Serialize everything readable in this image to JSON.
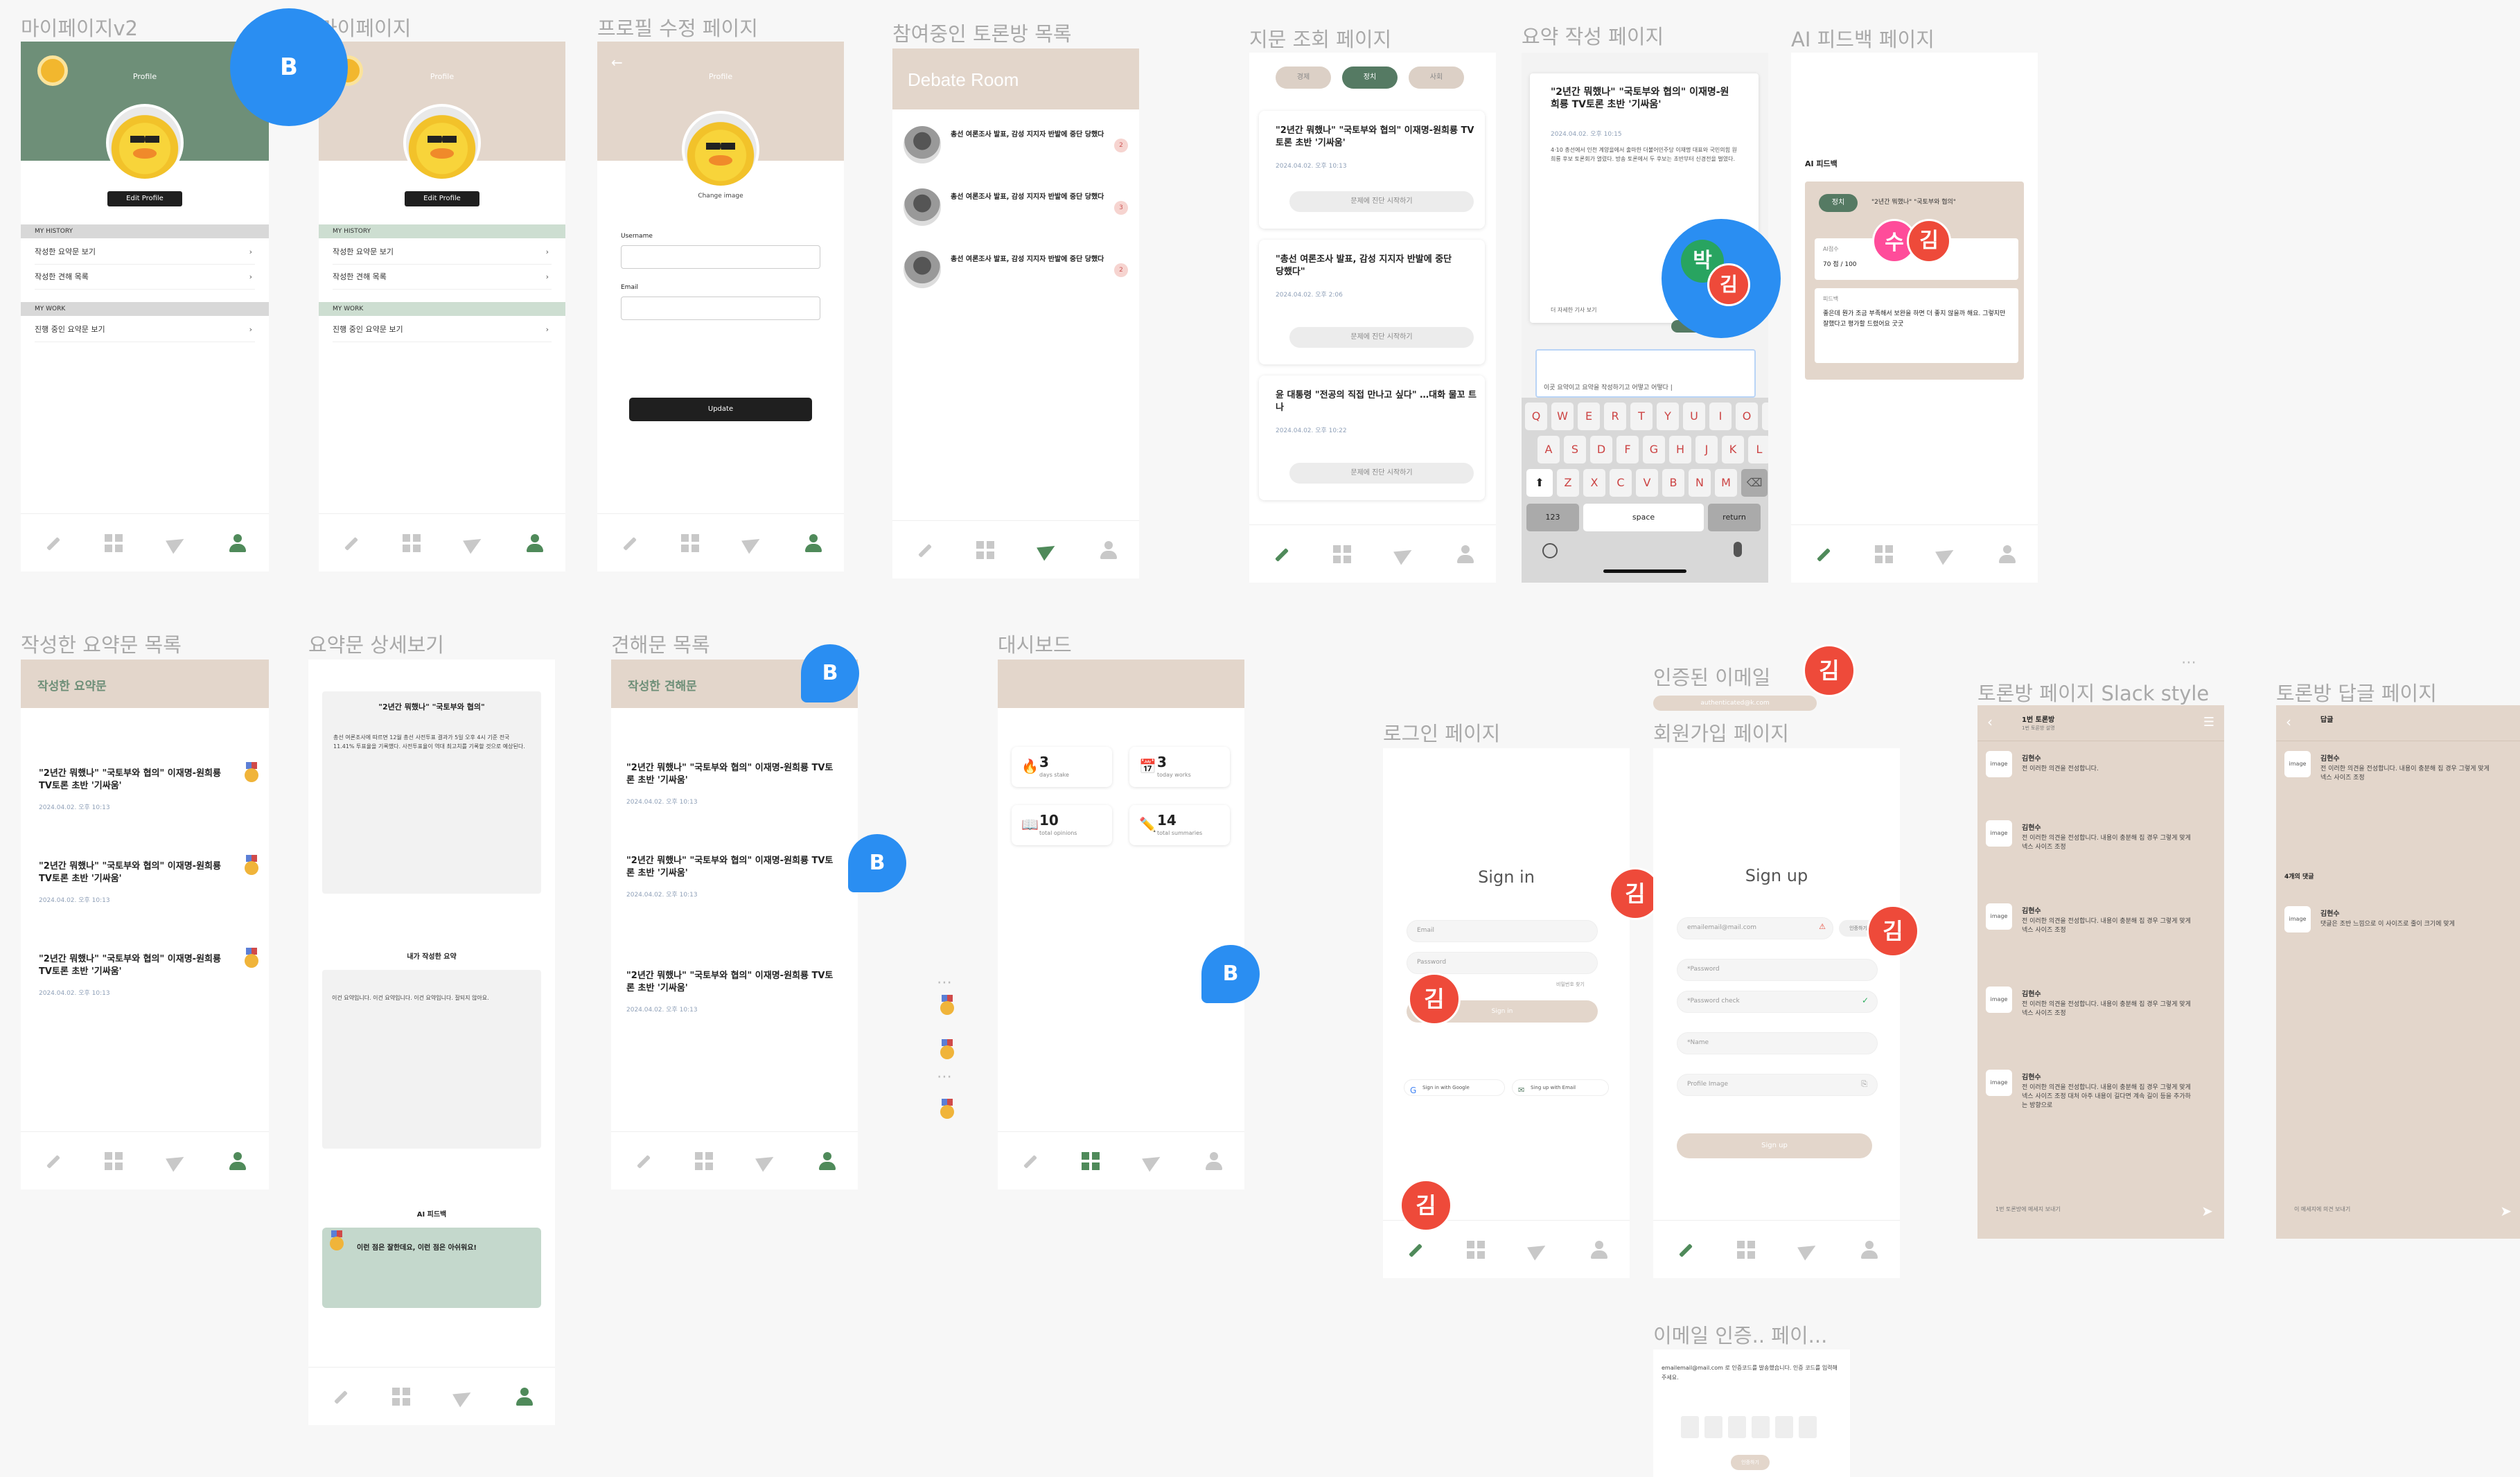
{
  "labels": {
    "mypage_v2": "마이페이지v2",
    "mypage": "마이페이지",
    "profile_edit": "프로필 수정 페이지",
    "debate_list": "참여중인 토론방 목록",
    "question_view": "지문 조회 페이지",
    "summary_write": "요약 작성 페이지",
    "ai_feedback": "AI 피드백 페이지",
    "my_summaries": "작성한 요약문 목록",
    "summary_detail": "요약문 상세보기",
    "opinion_list": "견해문 목록",
    "dashboard": "대시보드",
    "login": "로그인 페이지",
    "verified_email": "인증된 이메일",
    "signup": "회원가입 페이지",
    "room_slack": "토론방 페이지 Slack style",
    "room_reply": "토론방 답글 페이지",
    "email_verify": "이메일 인증.. 페이..."
  },
  "profile": {
    "header": "Profile",
    "edit_button": "Edit Profile",
    "my_history": "MY HISTORY",
    "history_items": [
      "작성한 요약문 보기",
      "작성한 견해 목록"
    ],
    "my_work": "MY WORK",
    "work_items": [
      "진행 중인 요약문 보기"
    ]
  },
  "profile_edit": {
    "header": "Profile",
    "change_image": "Change image",
    "username_label": "Username",
    "email_label": "Email",
    "update_button": "Update"
  },
  "debate": {
    "header": "Debate Room",
    "items": [
      {
        "title": "총선 여론조사 발표, 감성 지지자 반발에 중단 당했다",
        "badge": "2"
      },
      {
        "title": "총선 여론조사 발표, 감성 지지자 반발에 중단 당했다",
        "badge": "3"
      },
      {
        "title": "총선 여론조사 발표, 감성 지지자 반발에 중단 당했다",
        "badge": "2"
      }
    ]
  },
  "question": {
    "tabs": [
      "경제",
      "정치",
      "사회"
    ],
    "articles": [
      {
        "title": "\"2년간 뭐했나\" \"국토부와 협의\" 이재명-원희룡 TV토론 초반 '기싸움'",
        "meta": "2024.04.02. 오후 10:13",
        "button": "문제에 진단 시작하기"
      },
      {
        "title": "\"총선 여론조사 발표, 감성 지지자 반발에 중단 당했다\"",
        "meta": "2024.04.02. 오후 2:06",
        "button": "문제에 진단 시작하기"
      },
      {
        "title": "윤 대통령 \"전공의 직접 만나고 싶다\" …대화 물꼬 트나",
        "meta": "2024.04.02. 오후 10:22",
        "button": "문제에 진단 시작하기"
      }
    ]
  },
  "summary_write": {
    "title": "\"2년간 뭐했나\" \"국토부와 협의\" 이재명-원희룡 TV토론 초반 '기싸움'",
    "meta": "2024.04.02. 오후 10:15",
    "body": "4·10 총선에서 인천 계양을에서 출마한 더불어민주당 이재명 대표와 국민의힘 원희룡 후보 토론회가 열렸다. 방송 토론에서 두 후보는 초반부터 신경전을 벌였다.",
    "footer": "더 자세한 기사 보기",
    "input_placeholder": "이곳 요약이고 요약을 작성하기고 어떻고 어떻다 |",
    "keys_row1": [
      "Q",
      "W",
      "E",
      "R",
      "T",
      "Y",
      "U",
      "I",
      "O",
      "P"
    ],
    "keys_row2": [
      "A",
      "S",
      "D",
      "F",
      "G",
      "H",
      "J",
      "K",
      "L"
    ],
    "keys_row3": [
      "Z",
      "X",
      "C",
      "V",
      "B",
      "N",
      "M"
    ],
    "key_123": "123",
    "key_space": "space",
    "key_return": "return"
  },
  "ai_feedback": {
    "section": "AI 피드백",
    "tag": "정치",
    "title": "\"2년간 뭐했나\" \"국토부와 협의\"",
    "score_label": "AI점수",
    "score": "70 점 / 100",
    "feedback_label": "피드백",
    "feedback": "좋은데 뭔가 조금 부족해서 보완을 하면 더 좋지 않을까 해요. 그렇지만 잘했다고 평가할 드렸어요 굿굿"
  },
  "my_summaries": {
    "header": "작성한 요약문",
    "items": [
      {
        "title": "\"2년간 뭐했나\" \"국토부와 협의\" 이재명-원희룡 TV토론 초반 '기싸움'",
        "meta": "2024.04.02. 오후 10:13"
      },
      {
        "title": "\"2년간 뭐했나\" \"국토부와 협의\" 이재명-원희룡 TV토론 초반 '기싸움'",
        "meta": "2024.04.02. 오후 10:13"
      },
      {
        "title": "\"2년간 뭐했나\" \"국토부와 협의\" 이재명-원희룡 TV토론 초반 '기싸움'",
        "meta": "2024.04.02. 오후 10:13"
      }
    ]
  },
  "summary_detail": {
    "title": "\"2년간 뭐했나\" \"국토부와 협의\"",
    "body": "총선 여론조사에 따르면 12월 총선 사전투표 결과가 5일 오후 4시 기준 전국 11.41% 투표율을 기록했다. 사전투표율이 역대 최고치를 기록할 것으로 예상된다.",
    "mine_title": "내가 작성한 요약",
    "mine_body": "이건 요약입니다. 이건 요약입니다. 이건 요약입니다. 잘되지 않아요.",
    "ai_title": "AI 피드백",
    "ai_body": "이런 점은 잘한데요, 이런 점은 아쉬워요!"
  },
  "opinions": {
    "header": "작성한 견해문",
    "items": [
      {
        "title": "\"2년간 뭐했나\" \"국토부와 협의\" 이재명-원희룡 TV토론 초반 '기싸움'",
        "meta": "2024.04.02. 오후 10:13"
      },
      {
        "title": "\"2년간 뭐했나\" \"국토부와 협의\" 이재명-원희룡 TV토론 초반 '기싸움'",
        "meta": "2024.04.02. 오후 10:13"
      },
      {
        "title": "\"2년간 뭐했나\" \"국토부와 협의\" 이재명-원희룡 TV토론 초반 '기싸움'",
        "meta": "2024.04.02. 오후 10:13"
      }
    ]
  },
  "dashboard": {
    "stats": [
      {
        "icon": "🔥",
        "value": "3",
        "sub": "days stake"
      },
      {
        "icon": "📅",
        "value": "3",
        "sub": "today works"
      },
      {
        "icon": "📖",
        "value": "10",
        "sub": "total opinions"
      },
      {
        "icon": "✏️",
        "value": "14",
        "sub": "total summaries"
      }
    ]
  },
  "login": {
    "title": "Sign in",
    "email": "Email",
    "password": "Password",
    "forgot": "비밀번호 찾기",
    "signin_button": "Sign in",
    "google": "Sign in with Google",
    "email_signup": "Sing up with Email"
  },
  "verified_email": {
    "email": "authenticated@k.com"
  },
  "signup": {
    "title": "Sign up",
    "email": "emailemail@mail.com",
    "verify": "인증하기",
    "password": "*Password",
    "password_check": "*Password check",
    "name": "*Name",
    "profile_image": "Profile Image",
    "button": "Sign up"
  },
  "room": {
    "title": "1번 토론방",
    "sub": "1번 토론방 설명",
    "messages": [
      {
        "name": "김현수",
        "text": "전 이러한 의견을 전성합니다."
      },
      {
        "name": "김현수",
        "text": "전 이러한 의견을 전성합니다. 내용이 충분해 집 경우 그렇게 맞게 넥스 사이즈 조정"
      },
      {
        "name": "김현수",
        "text": "전 이러한 의견을 전성합니다. 내용이 충분해 집 경우 그렇게 맞게 넥스 사이즈 조정"
      },
      {
        "name": "김현수",
        "text": "전 이러한 의견을 전성합니다. 내용이 충분해 집 경우 그렇게 맞게 넥스 사이즈 조정"
      },
      {
        "name": "김현수",
        "text": "전 이러한 의견을 전성합니다. 내용이 충분해 집 경우 그렇게 맞게 넥스 사이즈 조정 대처 아주 내용이 길다면 계속 길이 등을 추가하는 방향으로"
      }
    ],
    "input": "1번 토론방에 메세지 보내기",
    "image_label": "image"
  },
  "reply": {
    "title": "답글",
    "name": "김현수",
    "text": "전 이러한 의견을 전성합니다. 내용이 충분해 집 경우 그렇게 맞게 넥스 사이즈 조정",
    "count": "4개의 댓글",
    "reply_text": "댓글은 조반 느낌으로 이 사이즈로 줄이 크기에 맞게",
    "input": "이 메세지에 의견 보내기"
  },
  "email_verify": {
    "text": "emailemail@mail.com 로 인증코드를 발송했습니다. 인증 코드를 입력해주세요.",
    "button": "인증하기"
  },
  "cursors": {
    "b": "B",
    "kim": "김",
    "park": "박",
    "su": "수"
  }
}
